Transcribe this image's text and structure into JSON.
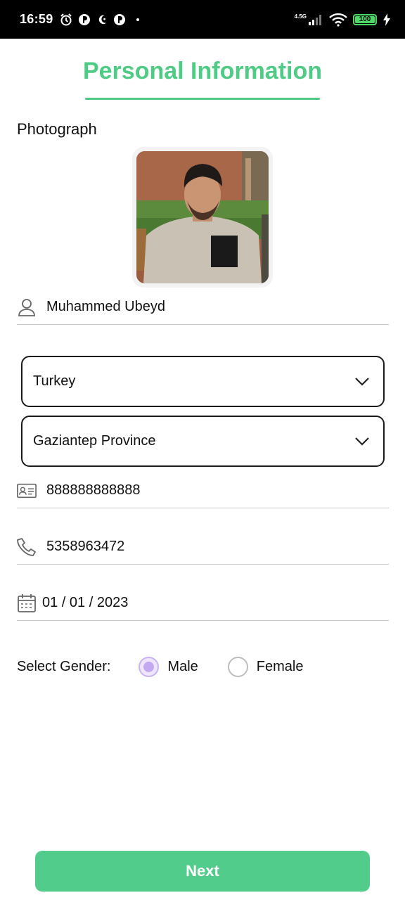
{
  "status_bar": {
    "time": "16:59",
    "network": "4.5G",
    "battery": "100",
    "battery_level": 1.0
  },
  "page": {
    "title": "Personal Information",
    "accent_color": "#4ecb85"
  },
  "photo_section": {
    "label": "Photograph"
  },
  "form": {
    "name": "Muhammed Ubeyd",
    "country": "Turkey",
    "province": "Gaziantep Province",
    "id_number": "888888888888",
    "phone": "5358963472",
    "birth_date": "01 / 01 / 2023"
  },
  "gender": {
    "label": "Select Gender:",
    "options": [
      "Male",
      "Female"
    ],
    "selected": "Male"
  },
  "actions": {
    "next_label": "Next"
  },
  "icons": {
    "name": "person-icon",
    "id": "id-card-icon",
    "phone": "phone-icon",
    "date": "calendar-icon",
    "dropdown": "chevron-down-icon"
  }
}
